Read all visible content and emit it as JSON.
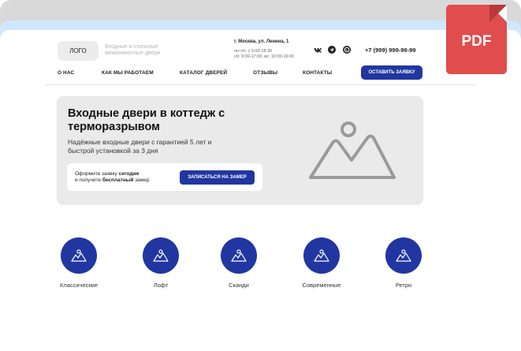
{
  "header": {
    "logo": "ЛОГО",
    "tagline": "Входные и стильные межкомнатные двери",
    "address": "г. Москва, ул. Ленина, 1",
    "hours_line1": "пн–пт: с 9:00-18:30",
    "hours_line2": "сб: 9:00-17:00, вс: 10:00-16:00",
    "phone": "+7 (999) 999-99-99",
    "social_icons": [
      "vk-icon",
      "telegram-icon",
      "whatsapp-icon"
    ]
  },
  "nav": {
    "items": [
      "О НАС",
      "КАК МЫ РАБОТАЕМ",
      "КАТАЛОГ ДВЕРЕЙ",
      "ОТЗЫВЫ",
      "КОНТАКТЫ"
    ],
    "cta": "ОСТАВИТЬ ЗАЯВКУ"
  },
  "hero": {
    "title": "Входные двери в коттедж с терморазрывом",
    "subtitle": "Надёжные входные двери с гарантией 5 лет и быстрой установкой за 3 дня",
    "card_text_prefix": "Оформите заявку ",
    "card_text_bold1": "сегодня",
    "card_text_mid": "и получите ",
    "card_text_bold2": "бесплатный",
    "card_text_suffix": " замер",
    "card_button": "ЗАПИСАТЬСЯ НА ЗАМЕР",
    "image_icon": "image-placeholder-icon"
  },
  "categories": [
    {
      "label": "Классические"
    },
    {
      "label": "Лофт"
    },
    {
      "label": "Сканди"
    },
    {
      "label": "Современные"
    },
    {
      "label": "Ретро"
    }
  ],
  "badge": {
    "label": "PDF",
    "color": "#e04d4d"
  },
  "colors": {
    "accent": "#2136a1",
    "hero_bg": "#eaeaea"
  }
}
